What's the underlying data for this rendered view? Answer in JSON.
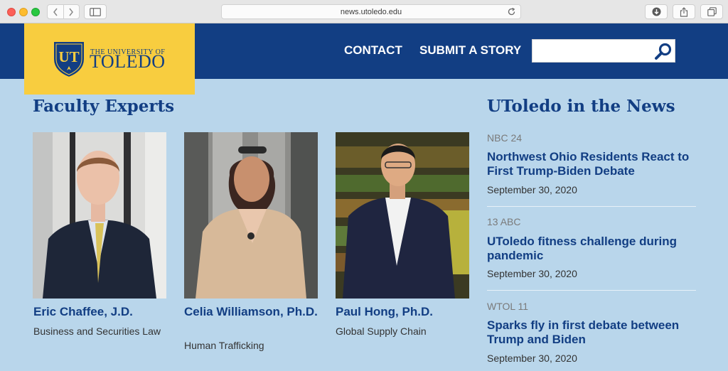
{
  "browser": {
    "url": "news.utoledo.edu"
  },
  "header": {
    "logo_line1": "THE UNIVERSITY OF",
    "logo_line2": "TOLEDO",
    "logo_monogram": "UT",
    "nav": [
      "CONTACT",
      "SUBMIT A STORY"
    ],
    "search": {
      "value": "",
      "placeholder": ""
    }
  },
  "faculty": {
    "heading": "Faculty Experts",
    "experts": [
      {
        "name": "Eric Chaffee, J.D.",
        "specialty": "Business and Securities Law"
      },
      {
        "name": "Celia Williamson, Ph.D.",
        "specialty": "Human Trafficking"
      },
      {
        "name": "Paul Hong, Ph.D.",
        "specialty": "Global Supply Chain"
      }
    ]
  },
  "news": {
    "heading": "UToledo in the News",
    "items": [
      {
        "source": "NBC 24",
        "headline": "Northwest Ohio Residents React to First Trump-Biden Debate",
        "date": "September 30, 2020"
      },
      {
        "source": "13 ABC",
        "headline": "UToledo fitness challenge during pandemic",
        "date": "September 30, 2020"
      },
      {
        "source": "WTOL 11",
        "headline": "Sparks fly in first debate between Trump and Biden",
        "date": "September 30, 2020"
      }
    ]
  },
  "colors": {
    "brand_blue": "#123e83",
    "brand_gold": "#f8cd3f",
    "page_bg": "#b9d6eb"
  }
}
